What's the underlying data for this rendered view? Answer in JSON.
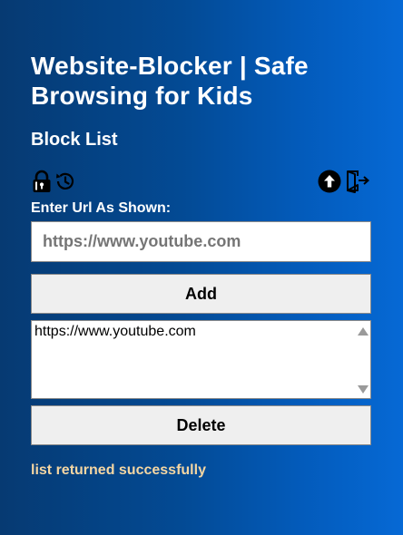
{
  "app": {
    "title": "Website-Blocker | Safe Browsing for Kids"
  },
  "section": {
    "title": "Block List"
  },
  "toolbar": {
    "icons": [
      "lock-icon",
      "restore-icon",
      "upload-icon",
      "logout-icon"
    ]
  },
  "form": {
    "label": "Enter Url As Shown:",
    "placeholder": "https://www.youtube.com",
    "value": "",
    "add_label": "Add"
  },
  "list": {
    "items": [
      "https://www.youtube.com"
    ]
  },
  "actions": {
    "delete_label": "Delete"
  },
  "status": {
    "message": "list returned successfully"
  },
  "colors": {
    "status_text": "#f4d6a3",
    "background_start": "#063a72",
    "background_end": "#0669d5"
  }
}
